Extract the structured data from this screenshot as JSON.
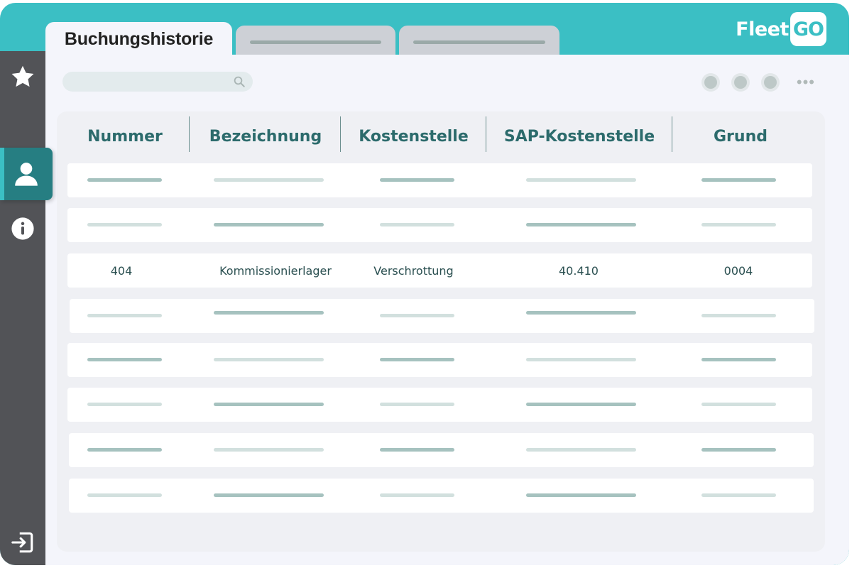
{
  "brand": {
    "logo_left": "Fleet",
    "logo_right": "GO",
    "accent": "#3bbfc4",
    "sidebar_bg": "#525357",
    "active_bg": "#267e82"
  },
  "tabs": [
    {
      "label": "Buchungshistorie",
      "active": true
    },
    {
      "label": "",
      "active": false
    },
    {
      "label": "",
      "active": false
    }
  ],
  "sidebar": {
    "items": [
      {
        "icon": "star-icon"
      },
      {
        "icon": "user-icon",
        "active": true
      },
      {
        "icon": "help-icon"
      },
      {
        "icon": "info-icon"
      },
      {
        "icon": "logout-icon"
      }
    ]
  },
  "toolbar": {
    "search_placeholder": "",
    "more_glyph": "•••"
  },
  "table": {
    "columns": [
      "Nummer",
      "Bezeichnung",
      "Kostenstelle",
      "SAP-Kostenstelle",
      "Grund"
    ],
    "highlighted_row": {
      "nummer": "404",
      "bezeichnung": "Kommissionierlager",
      "kostenstelle": "Verschrottung",
      "sap_kostenstelle": "40.410",
      "grund": "0004"
    }
  }
}
